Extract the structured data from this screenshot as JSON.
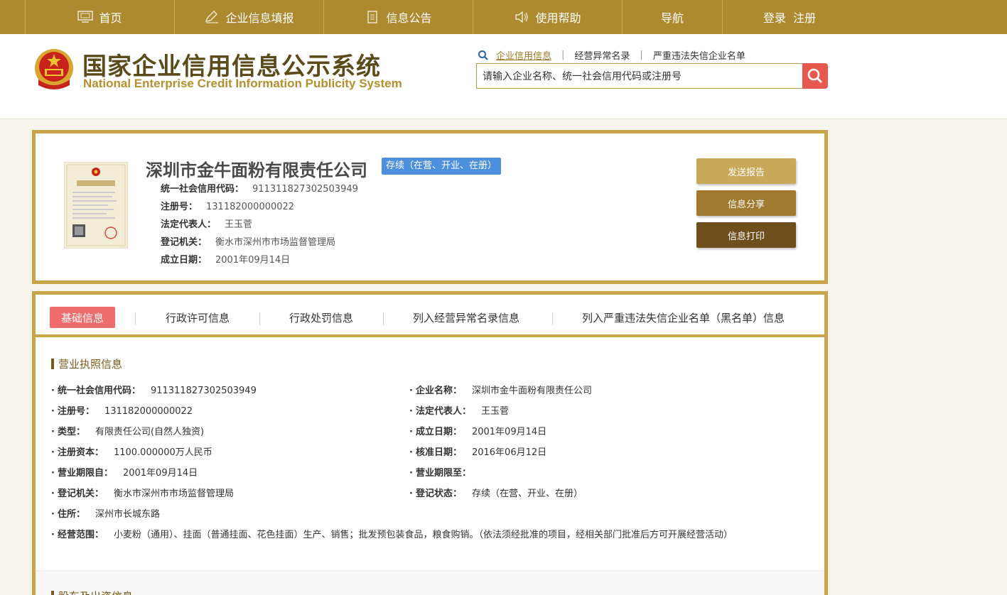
{
  "topnav": {
    "items": [
      {
        "label": "首页",
        "icon": "monitor-icon"
      },
      {
        "label": "企业信息填报",
        "icon": "edit-icon"
      },
      {
        "label": "信息公告",
        "icon": "document-icon"
      },
      {
        "label": "使用帮助",
        "icon": "speaker-icon"
      },
      {
        "label": "导航",
        "icon": ""
      },
      {
        "label": "登录  注册",
        "icon": ""
      }
    ]
  },
  "header": {
    "title": "国家企业信用信息公示系统",
    "subtitle": "National Enterprise Credit Information Publicity System",
    "search_tabs": [
      "企业信用信息",
      "经营异常名录",
      "严重违法失信企业名单"
    ],
    "search_placeholder": "请输入企业名称、统一社会信用代码或注册号"
  },
  "company": {
    "name": "深圳市金牛面粉有限责任公司",
    "status": "存续（在营、开业、在册）",
    "fields": [
      {
        "key": "统一社会信用代码：",
        "value": "911311827302503949"
      },
      {
        "key": "注册号：",
        "value": "131182000000022"
      },
      {
        "key": "法定代表人：",
        "value": "王玉菅"
      },
      {
        "key": "登记机关：",
        "value": "衡水市深州市市场监督管理局"
      },
      {
        "key": "成立日期：",
        "value": "2001年09月14日"
      }
    ],
    "buttons": {
      "send": "发送报告",
      "share": "信息分享",
      "print": "信息打印"
    }
  },
  "tabs": [
    "基础信息",
    "行政许可信息",
    "行政处罚信息",
    "列入经营异常名录信息",
    "列入严重违法失信企业名单（黑名单）信息"
  ],
  "license_section": {
    "title": "营业执照信息",
    "left": [
      {
        "key": "统一社会信用代码：",
        "value": "911311827302503949"
      },
      {
        "key": "注册号：",
        "value": "131182000000022"
      },
      {
        "key": "类型：",
        "value": "有限责任公司(自然人独资)"
      },
      {
        "key": "注册资本：",
        "value": "1100.000000万人民币"
      },
      {
        "key": "营业期限自：",
        "value": "2001年09月14日"
      },
      {
        "key": "登记机关：",
        "value": "衡水市深州市市场监督管理局"
      },
      {
        "key": "住所：",
        "value": "深州市长城东路"
      },
      {
        "key": "经营范围：",
        "value": "小麦粉（通用）、挂面（普通挂面、花色挂面）生产、销售；批发预包装食品，粮食购销。（依法须经批准的项目，经相关部门批准后方可开展经营活动）"
      }
    ],
    "right": [
      {
        "key": "企业名称：",
        "value": "深圳市金牛面粉有限责任公司"
      },
      {
        "key": "法定代表人：",
        "value": "王玉菅"
      },
      {
        "key": "成立日期：",
        "value": "2001年09月14日"
      },
      {
        "key": "核准日期：",
        "value": "2016年06月12日"
      },
      {
        "key": "营业期限至：",
        "value": ""
      },
      {
        "key": "登记状态：",
        "value": "存续（在营、开业、在册）"
      }
    ]
  },
  "next_section": {
    "title": "股东及出资信息"
  },
  "colors": {
    "gold": "#ad8a2f",
    "border": "#c9a448",
    "badge": "#4d91de",
    "active_tab": "#ef6c6c",
    "search_btn": "#e8584e"
  }
}
